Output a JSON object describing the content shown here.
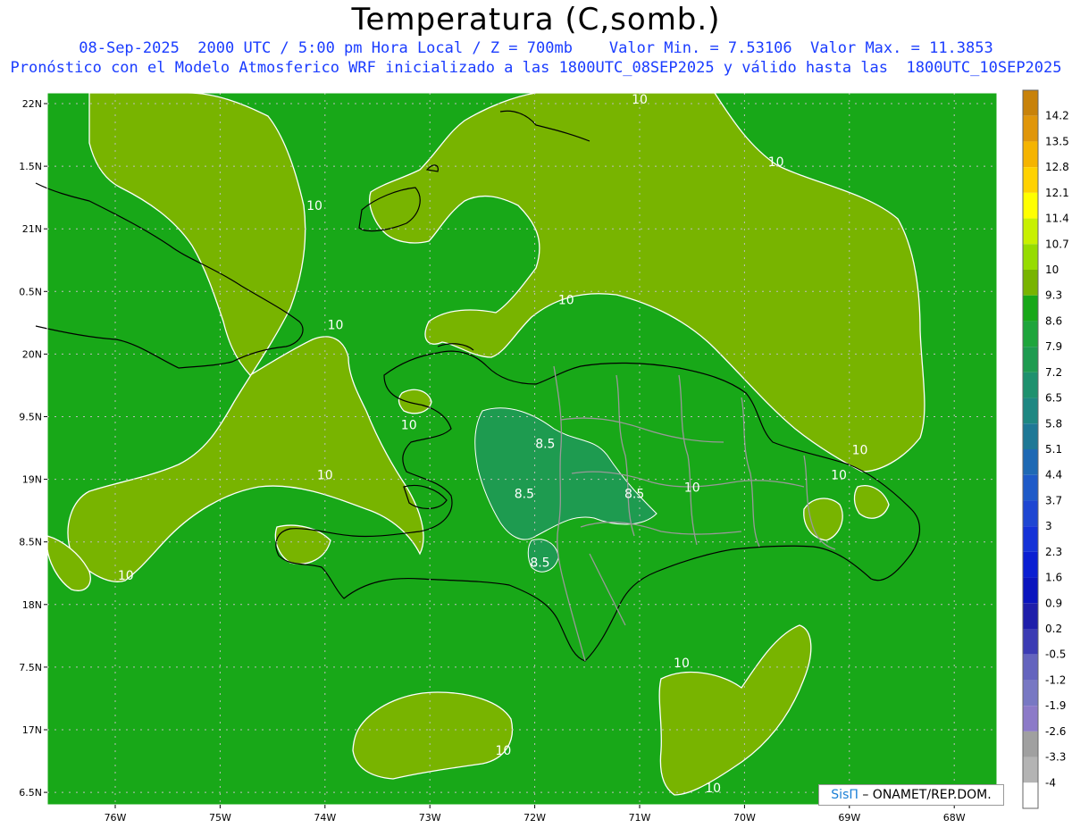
{
  "title": "Temperatura (C,somb.)",
  "subtitle_line1": "08-Sep-2025  2000 UTC / 5:00 pm Hora Local / Z = 700mb    Valor Min. = 7.53106  Valor Max. = 11.3853",
  "subtitle_line2": "Pronóstico con el Modelo Atmosferico WRF inicializado a las 1800UTC_08SEP2025 y válido hasta las  1800UTC_10SEP2025",
  "credit": {
    "brand": "SisΠ",
    "text": "– ONAMET/REP.DOM."
  },
  "lat_labels": [
    "22N",
    "1.5N",
    "21N",
    "0.5N",
    "20N",
    "9.5N",
    "19N",
    "8.5N",
    "18N",
    "7.5N",
    "17N",
    "6.5N"
  ],
  "lat_values": [
    22,
    21.5,
    21,
    20.5,
    20,
    19.5,
    19,
    18.5,
    18,
    17.5,
    17,
    16.5
  ],
  "lon_labels": [
    "76W",
    "75W",
    "74W",
    "73W",
    "72W",
    "71W",
    "70W",
    "69W",
    "68W"
  ],
  "lon_values": [
    -76,
    -75,
    -74,
    -73,
    -72,
    -71,
    -70,
    -69,
    -68
  ],
  "contour_labels": [
    {
      "text": "10",
      "lon": -75.9,
      "lat": 18.2
    },
    {
      "text": "10",
      "lon": -74.1,
      "lat": 21.15
    },
    {
      "text": "10",
      "lon": -73.2,
      "lat": 19.4
    },
    {
      "text": "10",
      "lon": -74.0,
      "lat": 19.0
    },
    {
      "text": "10",
      "lon": -71.7,
      "lat": 20.4
    },
    {
      "text": "10",
      "lon": -73.9,
      "lat": 20.2
    },
    {
      "text": "10",
      "lon": -71.0,
      "lat": 22.0
    },
    {
      "text": "10",
      "lon": -69.7,
      "lat": 21.5
    },
    {
      "text": "10",
      "lon": -68.9,
      "lat": 19.2
    },
    {
      "text": "10",
      "lon": -69.1,
      "lat": 19.0
    },
    {
      "text": "10",
      "lon": -70.5,
      "lat": 18.9
    },
    {
      "text": "10",
      "lon": -70.6,
      "lat": 17.5
    },
    {
      "text": "10",
      "lon": -72.3,
      "lat": 16.8
    },
    {
      "text": "10",
      "lon": -70.3,
      "lat": 16.5
    },
    {
      "text": "8.5",
      "lon": -71.9,
      "lat": 19.25
    },
    {
      "text": "8.5",
      "lon": -72.1,
      "lat": 18.85
    },
    {
      "text": "8.5",
      "lon": -71.05,
      "lat": 18.85
    },
    {
      "text": "8.5",
      "lon": -71.95,
      "lat": 18.3
    }
  ],
  "colorbar": {
    "labels": [
      "14.2",
      "13.5",
      "12.8",
      "12.1",
      "11.4",
      "10.7",
      "10",
      "9.3",
      "8.6",
      "7.9",
      "7.2",
      "6.5",
      "5.8",
      "5.1",
      "4.4",
      "3.7",
      "3",
      "2.3",
      "1.6",
      "0.9",
      "0.2",
      "-0.5",
      "-1.2",
      "-1.9",
      "-2.6",
      "-3.3",
      "-4"
    ],
    "colors": [
      "#c8820a",
      "#e0960a",
      "#f5b400",
      "#ffd200",
      "#ffff00",
      "#c8f000",
      "#96dc00",
      "#78b400",
      "#18a818",
      "#1ea53c",
      "#1e9b50",
      "#1e916e",
      "#1e8782",
      "#1e7896",
      "#1e69b4",
      "#1e5ac8",
      "#1e46d2",
      "#1432d7",
      "#0a1ed2",
      "#0a14be",
      "#1e1eaa",
      "#3c3cb4",
      "#6464be",
      "#7878c3",
      "#8c7ac8",
      "#a0a0a0",
      "#b4b4b4",
      "#ffffff"
    ]
  },
  "colors": {
    "field_base": "#18a818",
    "field_warm": "#78b400",
    "field_cool": "#1e9b50",
    "contour": "#ffffff",
    "coast": "#000000",
    "provinces": "#999999"
  }
}
